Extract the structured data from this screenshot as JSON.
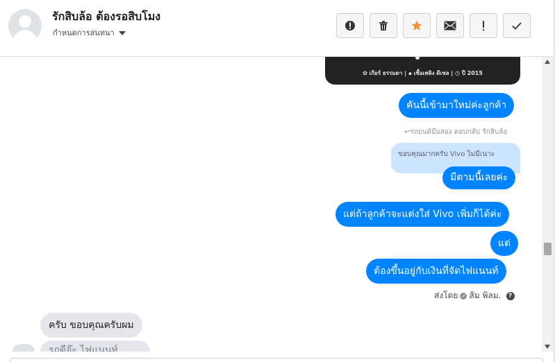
{
  "header": {
    "contact_name": "รักสิบล้อ ต้องรอสิบโมง",
    "subtitle": "กำหนดการสนทนา",
    "actions": [
      {
        "name": "report-button",
        "icon": "alert-circle-icon"
      },
      {
        "name": "delete-button",
        "icon": "trash-icon"
      },
      {
        "name": "star-button",
        "icon": "star-icon",
        "color": "#f7923a"
      },
      {
        "name": "mark-unread-button",
        "icon": "envelope-icon"
      },
      {
        "name": "important-button",
        "icon": "exclamation-icon"
      },
      {
        "name": "done-button",
        "icon": "check-icon"
      }
    ]
  },
  "image_card": {
    "specs": "✿ เกียร์ ธรรมดา   |   ๑ เชื้อเพลิง ดีเซล   |   ◷ ปี 2015"
  },
  "messages": {
    "m1": "คันนี้เข้ามาใหม่ค่ะลูกค้า",
    "reply_meta": "↩รถยนต์มือสอง ตอบกลับ รักสิบล้อ",
    "quoted": "ขอบคุณมากครับ Vivo ไม่มีเนาะ",
    "m2": "มีตามนี้เลยค่ะ",
    "m3": "แต่ถ้าลูกค้าจะแต่งใส่ Vivo เพิ่มก็ได้ค่ะ",
    "m4": "แต่",
    "m5": "ต้องขึ้นอยู่กับเงินที่จัดไฟแนนท์",
    "sent_by_prefix": "ส่งโดย",
    "sent_by_name": "ส้ม พิลม.",
    "g1": "ครับ ขอบคุณครับผม",
    "g2": "รถดีจ๊ะ ไฟแนนท์"
  },
  "colors": {
    "outgoing": "#0084ff",
    "incoming": "#e4e6eb",
    "quoted": "#cce4ff"
  }
}
